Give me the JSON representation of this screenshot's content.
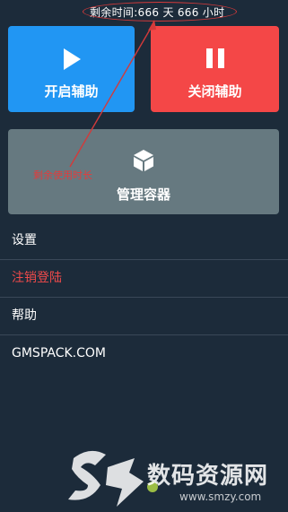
{
  "status": {
    "remaining_time": "剩余时间:666 天 666 小时"
  },
  "tiles": {
    "start": {
      "label": "开启辅助",
      "icon": "play-icon",
      "color": "#2196f3"
    },
    "stop": {
      "label": "关闭辅助",
      "icon": "pause-icon",
      "color": "#f44747"
    },
    "manage": {
      "label": "管理容器",
      "icon": "cube-icon",
      "color": "#667980"
    }
  },
  "annotation": {
    "text": "剩余使用时长",
    "color": "#d33a3a"
  },
  "menu": {
    "items": [
      {
        "label": "设置"
      },
      {
        "label": "注销登陆"
      },
      {
        "label": "帮助"
      },
      {
        "label": "GMSPACK.COM"
      }
    ]
  },
  "watermark": {
    "title": "数码资源网",
    "url": "www.smzy.com"
  }
}
